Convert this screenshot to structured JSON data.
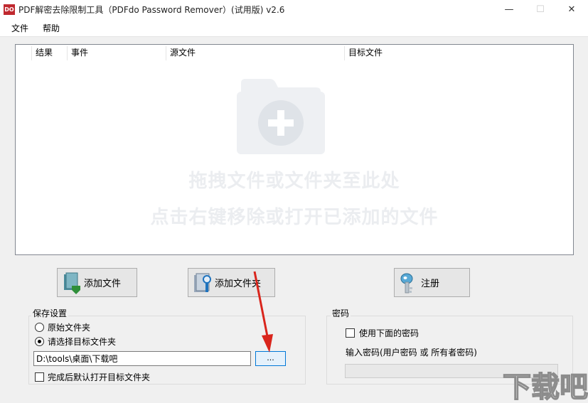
{
  "window": {
    "icon_text": "DO",
    "title": "PDF解密去除限制工具（PDFdo Password Remover）(试用版) v2.6",
    "minimize_glyph": "—",
    "maximize_glyph": "☐",
    "close_glyph": "✕"
  },
  "menu": {
    "file": "文件",
    "help": "帮助"
  },
  "file_list": {
    "columns": [
      "结果",
      "事件",
      "源文件",
      "目标文件"
    ],
    "rows": [],
    "drop_hint_line1": "拖拽文件或文件夹至此处",
    "drop_hint_line2": "点击右键移除或打开已添加的文件",
    "drop_icon": "folder-plus-icon"
  },
  "buttons": {
    "add_file": "添加文件",
    "add_folder": "添加文件夹",
    "register": "注册",
    "browse": "..."
  },
  "save_settings": {
    "title": "保存设置",
    "option_original": "原始文件夹",
    "option_choose": "请选择目标文件夹",
    "selected_option": "option_choose",
    "target_path": "D:\\tools\\桌面\\下载吧",
    "open_after_done": "完成后默认打开目标文件夹",
    "open_after_done_checked": false
  },
  "password": {
    "title": "密码",
    "use_below": "使用下面的密码",
    "use_below_checked": false,
    "enter_label": "输入密码(用户密码 或 所有者密码)",
    "value": ""
  },
  "watermark": {
    "text": "下载吧"
  },
  "colors": {
    "accent_blue": "#0078d7",
    "arrow_red": "#d9251c",
    "app_icon_red": "#c0292f"
  }
}
